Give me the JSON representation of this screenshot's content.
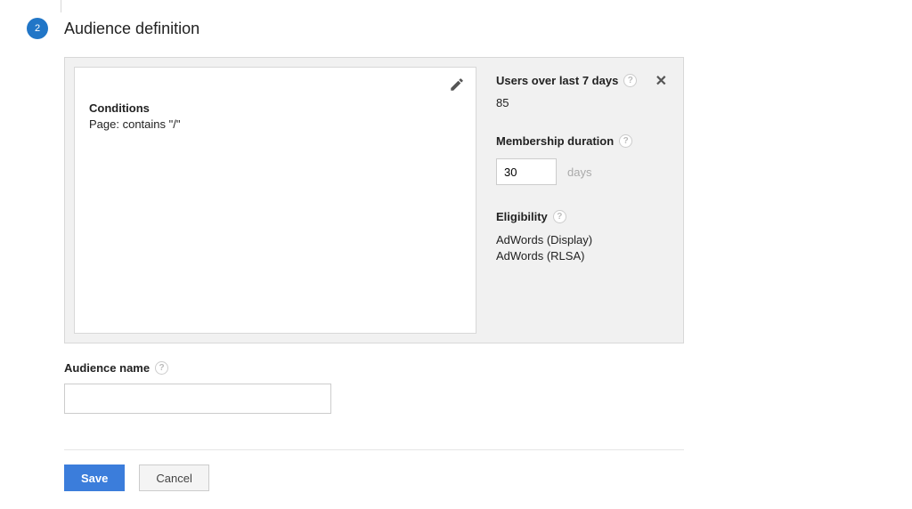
{
  "step": {
    "number": "2",
    "title": "Audience definition"
  },
  "conditions": {
    "heading": "Conditions",
    "text": "Page: contains \"/\""
  },
  "side": {
    "users_label": "Users over last 7 days",
    "users_value": "85",
    "membership_label": "Membership duration",
    "membership_value": "30",
    "membership_unit": "days",
    "eligibility_label": "Eligibility",
    "eligibility_items": [
      "AdWords (Display)",
      "AdWords (RLSA)"
    ]
  },
  "audience_name": {
    "label": "Audience name",
    "value": ""
  },
  "buttons": {
    "save": "Save",
    "cancel": "Cancel"
  },
  "help_glyph": "?"
}
